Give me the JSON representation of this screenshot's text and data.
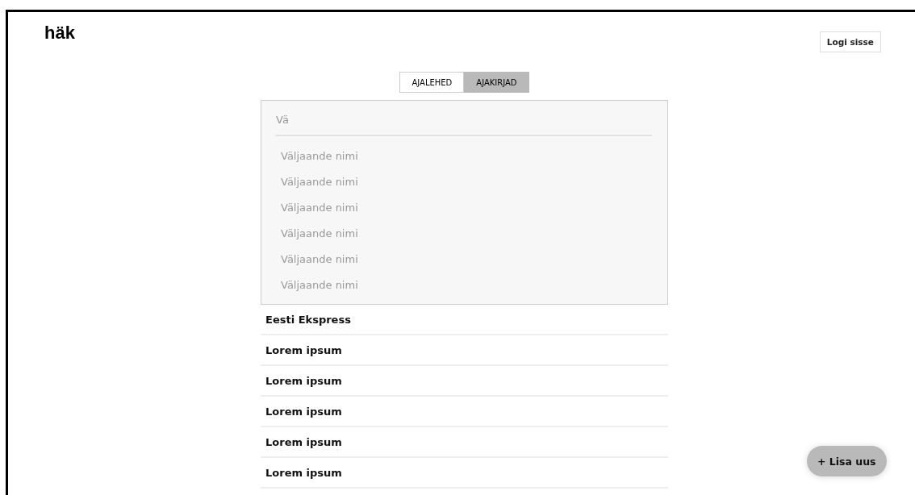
{
  "logo": "häk",
  "login_button": "Logi sisse",
  "tabs": [
    {
      "label": "AJALEHED",
      "selected": false
    },
    {
      "label": "AJAKIRJAD",
      "selected": true
    }
  ],
  "search": {
    "value": "Vä"
  },
  "suggestions": [
    "Väljaande nimi",
    "Väljaande nimi",
    "Väljaande nimi",
    "Väljaande nimi",
    "Väljaande nimi",
    "Väljaande nimi"
  ],
  "publications": [
    "Eesti Ekspress",
    "Lorem ipsum",
    "Lorem ipsum",
    "Lorem ipsum",
    "Lorem ipsum",
    "Lorem ipsum"
  ],
  "add_button": "+ Lisa uus"
}
